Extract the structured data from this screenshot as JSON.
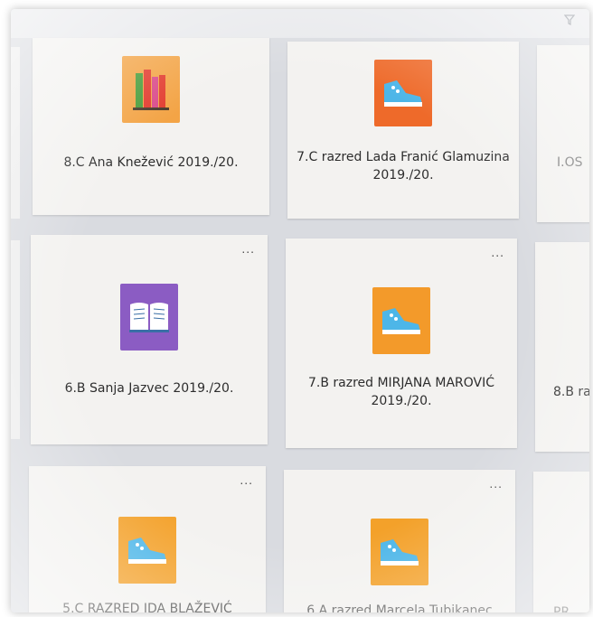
{
  "toolbar": {
    "filter_icon": "filter-icon"
  },
  "cards": [
    {
      "title": "8.C Ana Knežević 2019./20.",
      "icon": "books-icon",
      "icon_color": "#f3a446"
    },
    {
      "title": "7.C razred Lada Franić Glamuzina 2019./20.",
      "icon": "sneaker-icon",
      "icon_color": "#ee6a2a"
    },
    {
      "title": "I.OS",
      "icon": "",
      "icon_color": ""
    },
    {
      "title": "6.B Sanja Jazvec 2019./20.",
      "icon": "open-book-icon",
      "icon_color": "#8b5cc3"
    },
    {
      "title": "7.B razred MIRJANA MAROVIĆ 2019./20.",
      "icon": "sneaker-icon",
      "icon_color": "#f39a2a"
    },
    {
      "title": "8.B ra",
      "icon": "",
      "icon_color": ""
    },
    {
      "title": "5.C RAZRED IDA BLAŽEVIĆ",
      "icon": "sneaker-icon",
      "icon_color": "#f3a12a"
    },
    {
      "title": "6.A razred Marcela Tubikanec",
      "icon": "sneaker-icon",
      "icon_color": "#f3a12a"
    },
    {
      "title": "PR",
      "icon": "",
      "icon_color": ""
    }
  ],
  "more_label": "..."
}
